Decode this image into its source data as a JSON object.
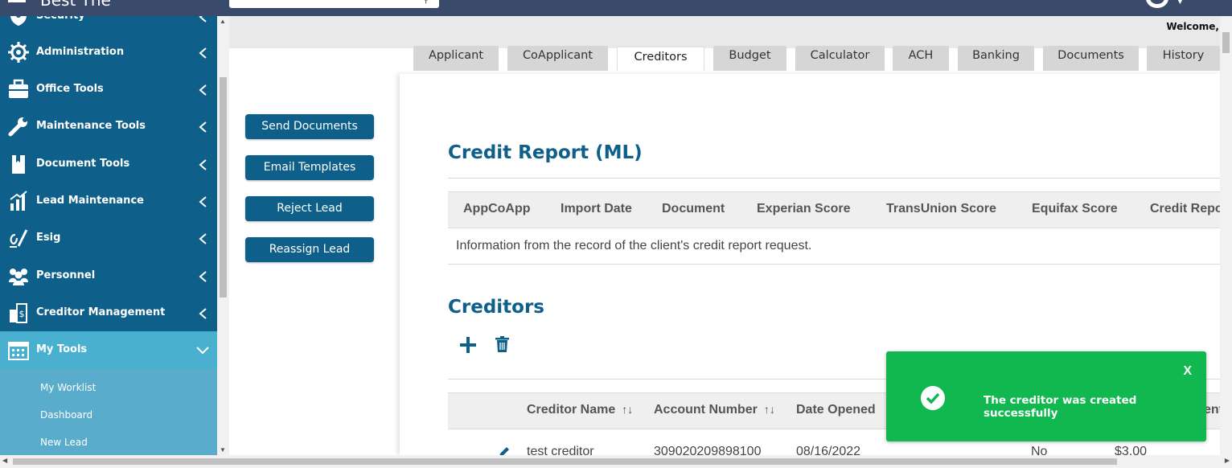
{
  "app": {
    "logo_text": "Best The"
  },
  "header": {
    "welcome": "Welcome,"
  },
  "sidebar": {
    "items": [
      {
        "label": "Security",
        "icon": "shield-icon"
      },
      {
        "label": "Administration",
        "icon": "gear-icon"
      },
      {
        "label": "Office Tools",
        "icon": "briefcase-icon"
      },
      {
        "label": "Maintenance Tools",
        "icon": "wrench-icon"
      },
      {
        "label": "Document Tools",
        "icon": "bookmark-document-icon"
      },
      {
        "label": "Lead Maintenance",
        "icon": "bar-chart-icon"
      },
      {
        "label": "Esig",
        "icon": "signature-icon"
      },
      {
        "label": "Personnel",
        "icon": "users-icon"
      },
      {
        "label": "Creditor Management",
        "icon": "building-dollar-icon"
      },
      {
        "label": "My Tools",
        "icon": "calendar-icon"
      }
    ],
    "submenu": [
      "My Worklist",
      "Dashboard",
      "New Lead"
    ]
  },
  "tabs": [
    {
      "label": "Applicant",
      "active": false
    },
    {
      "label": "CoApplicant",
      "active": false
    },
    {
      "label": "Creditors",
      "active": true
    },
    {
      "label": "Budget",
      "active": false
    },
    {
      "label": "Calculator",
      "active": false
    },
    {
      "label": "ACH",
      "active": false
    },
    {
      "label": "Banking",
      "active": false
    },
    {
      "label": "Documents",
      "active": false
    },
    {
      "label": "History",
      "active": false
    }
  ],
  "actions": [
    "Send Documents",
    "Email Templates",
    "Reject Lead",
    "Reassign Lead"
  ],
  "credit_report": {
    "title": "Credit Report (ML)",
    "columns": [
      "AppCoApp",
      "Import Date",
      "Document",
      "Experian Score",
      "TransUnion Score",
      "Equifax Score",
      "Credit Repo"
    ],
    "empty_message": "Information from the record of the client's credit report request."
  },
  "creditors": {
    "title": "Creditors",
    "columns": [
      "Creditor Name",
      "Account Number",
      "Date Opened",
      "ent"
    ],
    "sort_glyph": "↑↓",
    "rows": [
      {
        "name": "test creditor",
        "account": "309020209898100",
        "opened": "08/16/2022",
        "flag": "No",
        "amount": "$3.00"
      }
    ]
  },
  "toast": {
    "close": "X",
    "message": "The creditor was created successfully",
    "color": "#11b84f"
  },
  "colors": {
    "primary": "#0e5f8a",
    "active_nav": "#49b0cf",
    "submenu": "#5aaccc",
    "topbar": "#3a4a6b"
  }
}
